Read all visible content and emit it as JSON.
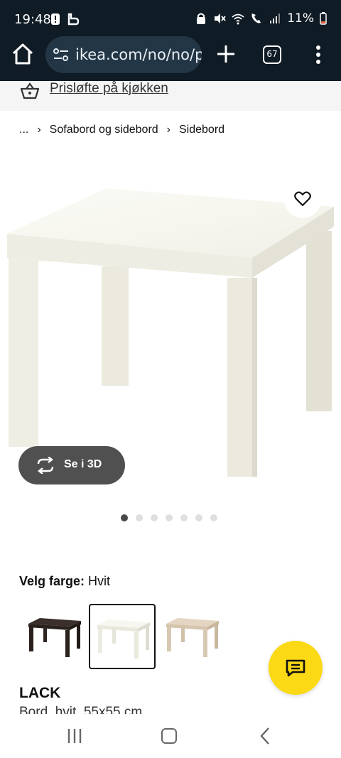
{
  "status": {
    "time": "19:48",
    "battery": "11%"
  },
  "browser": {
    "url": "ikea.com/no/no/p",
    "tab_count": "67"
  },
  "promo": {
    "text": "Prisløfte på kjøkken"
  },
  "breadcrumb": {
    "ellipsis": "...",
    "items": [
      "Sofabord og sidebord",
      "Sidebord"
    ]
  },
  "gallery": {
    "view_3d_label": "Se i 3D",
    "dot_count": 7,
    "active_dot": 0
  },
  "color_selector": {
    "label": "Velg farge:",
    "selected_value": "Hvit",
    "swatches": [
      {
        "name": "black-brown",
        "color": "#2f2622"
      },
      {
        "name": "white",
        "color": "#f4f3ec"
      },
      {
        "name": "white-stained-oak",
        "color": "#d8c8b2"
      }
    ],
    "selected_index": 1
  },
  "product": {
    "name": "LACK",
    "description": "Bord, hvit, 55x55 cm"
  },
  "colors": {
    "chrome_bg": "#0f1b25",
    "omnibox_bg": "#233646",
    "chat_yellow": "#fbd914",
    "button_3d_bg": "#505050"
  }
}
